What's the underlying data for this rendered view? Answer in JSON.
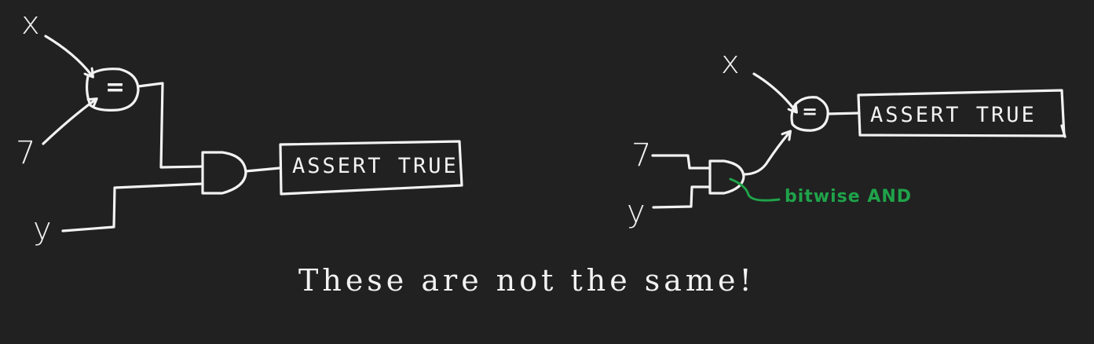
{
  "left_circuit": {
    "input_x": "x",
    "input_7": "7",
    "input_y": "y",
    "equals_symbol": "=",
    "assert_label": "ASSERT TRUE"
  },
  "right_circuit": {
    "input_x": "x",
    "input_7": "7",
    "input_y": "y",
    "equals_symbol": "=",
    "assert_label": "ASSERT TRUE",
    "annotation": "bitwise AND"
  },
  "caption": "These are not the same!",
  "colors": {
    "background": "#212121",
    "ink": "#f2f2f2",
    "annotation": "#1fa34a"
  }
}
